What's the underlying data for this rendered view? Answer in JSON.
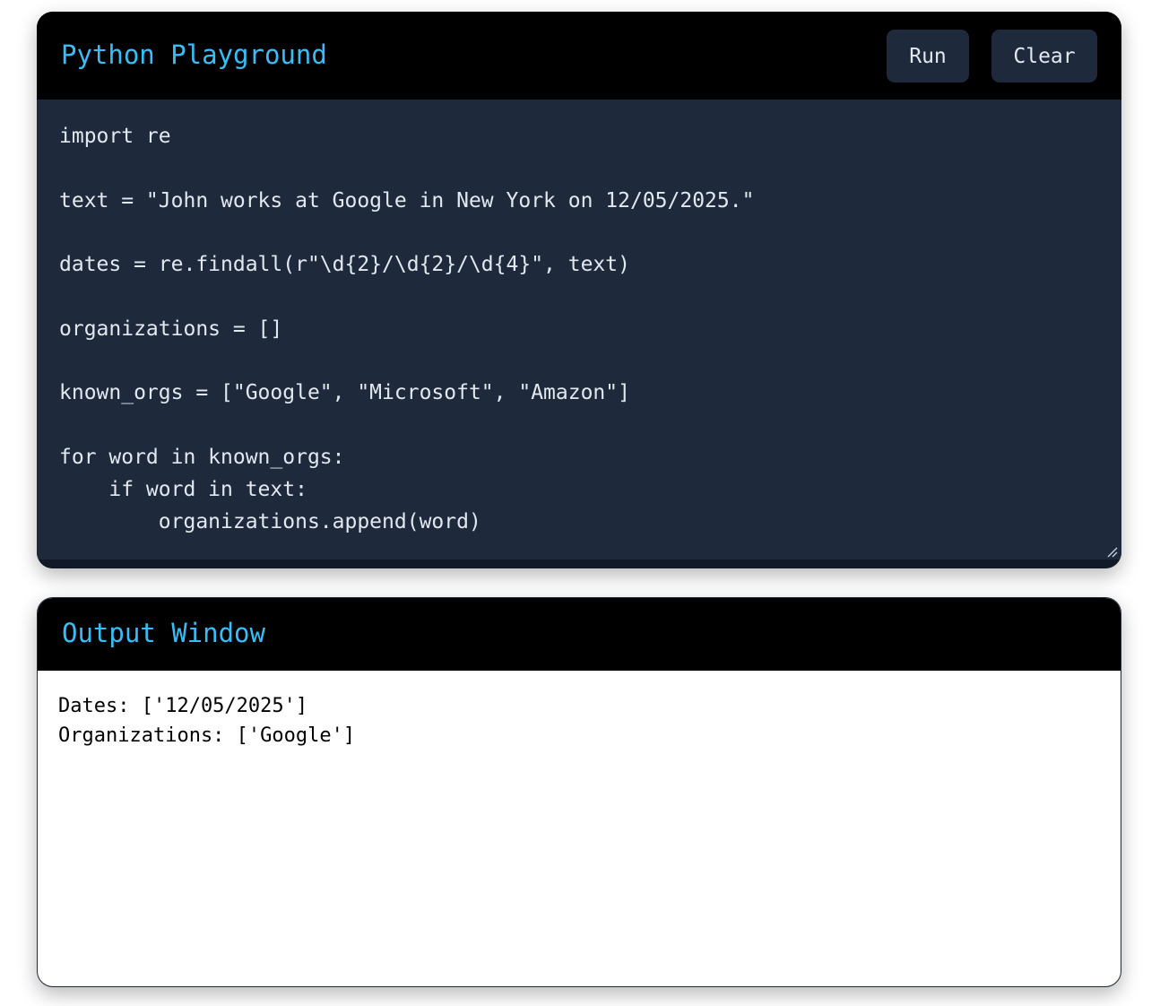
{
  "editor": {
    "title": "Python Playground",
    "run_label": "Run",
    "clear_label": "Clear",
    "code": "import re\n\ntext = \"John works at Google in New York on 12/05/2025.\"\n\ndates = re.findall(r\"\\d{2}/\\d{2}/\\d{4}\", text)\n\norganizations = []\n\nknown_orgs = [\"Google\", \"Microsoft\", \"Amazon\"]\n\nfor word in known_orgs:\n    if word in text:\n        organizations.append(word)"
  },
  "output": {
    "title": "Output Window",
    "text": "Dates: ['12/05/2025']\nOrganizations: ['Google']"
  },
  "colors": {
    "accent": "#38bdf8",
    "header_bg": "#000000",
    "editor_bg": "#1e293b",
    "button_bg": "#1e293b",
    "code_text": "#e2e8f0"
  }
}
